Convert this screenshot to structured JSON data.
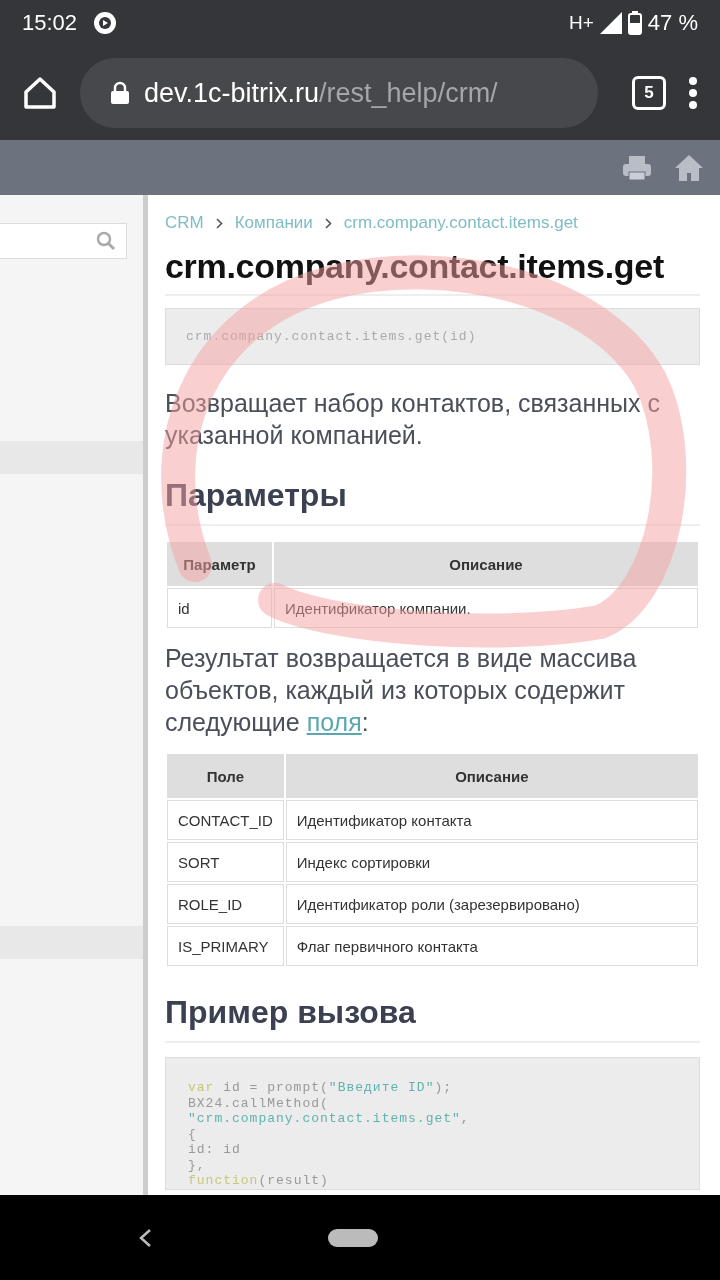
{
  "status_bar": {
    "time": "15:02",
    "network": "H+",
    "battery": "47 %"
  },
  "browser": {
    "url_domain": "dev.1c-bitrix.ru",
    "url_path": "/rest_help/crm/",
    "tab_count": "5"
  },
  "breadcrumbs": [
    "CRM",
    "Компании",
    "crm.company.contact.items.get"
  ],
  "title": "crm.company.contact.items.get",
  "signature": "crm.company.contact.items.get(id)",
  "description": "Возвращает набор контактов, связанных с указанной компанией.",
  "params_heading": "Параметры",
  "params_table": {
    "columns": [
      "Параметр",
      "Описание"
    ],
    "rows": [
      [
        "id",
        "Идентификатор компании."
      ]
    ]
  },
  "result_text": {
    "before": "Результат возвращается в виде массива объектов, каждый из которых содержит следующие ",
    "link": "поля",
    "after": ":"
  },
  "fields_table": {
    "columns": [
      "Поле",
      "Описание"
    ],
    "rows": [
      [
        "CONTACT_ID",
        "Идентификатор контакта"
      ],
      [
        "SORT",
        "Индекс сортировки"
      ],
      [
        "ROLE_ID",
        "Идентификатор роли (зарезервировано)"
      ],
      [
        "IS_PRIMARY",
        "Флаг первичного контакта"
      ]
    ]
  },
  "example_heading": "Пример вызова",
  "code_lines": [
    [
      {
        "kind": "keyword",
        "text": "var"
      },
      {
        "kind": "plain",
        "text": " id = prompt("
      },
      {
        "kind": "string",
        "text": "\"Введите ID\""
      },
      {
        "kind": "plain",
        "text": ");"
      }
    ],
    [
      {
        "kind": "plain",
        "text": "BX24.callMethod("
      }
    ],
    [
      {
        "kind": "string",
        "text": "\"crm.company.contact.items.get\""
      },
      {
        "kind": "plain",
        "text": ","
      }
    ],
    [
      {
        "kind": "plain",
        "text": "{"
      }
    ],
    [
      {
        "kind": "plain",
        "text": "id: id"
      }
    ],
    [
      {
        "kind": "plain",
        "text": "},"
      }
    ],
    [
      {
        "kind": "keyword",
        "text": "function"
      },
      {
        "kind": "plain",
        "text": "(result)"
      }
    ]
  ]
}
